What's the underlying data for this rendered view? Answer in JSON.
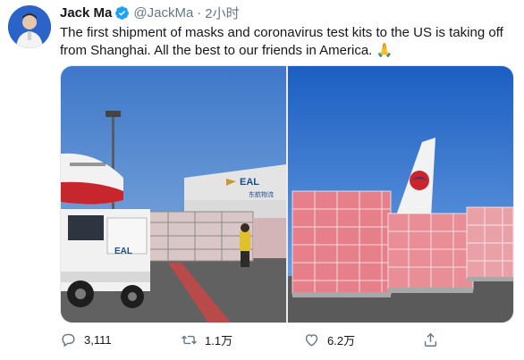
{
  "user": {
    "name": "Jack Ma",
    "handle": "@JackMa",
    "separator": "·",
    "time": "2小时",
    "verified": true
  },
  "tweet": {
    "text": "The first shipment of masks and coronavirus test kits to the US is taking off from Shanghai. All the best to our friends in America.",
    "emoji": "🙏"
  },
  "media": {
    "left_image": {
      "truck_logo": "EAL",
      "building_logo": "EAL",
      "building_sub": "东航物流"
    },
    "right_image": {}
  },
  "actions": {
    "reply_count": "3,111",
    "retweet_count": "1.1万",
    "like_count": "6.2万"
  },
  "icons": {
    "verified": "verified-badge-icon",
    "reply": "reply-icon",
    "retweet": "retweet-icon",
    "like": "heart-icon",
    "share": "share-icon"
  },
  "colors": {
    "verified_blue": "#1da1f2",
    "text_primary": "#14171a",
    "text_secondary": "#657786"
  }
}
